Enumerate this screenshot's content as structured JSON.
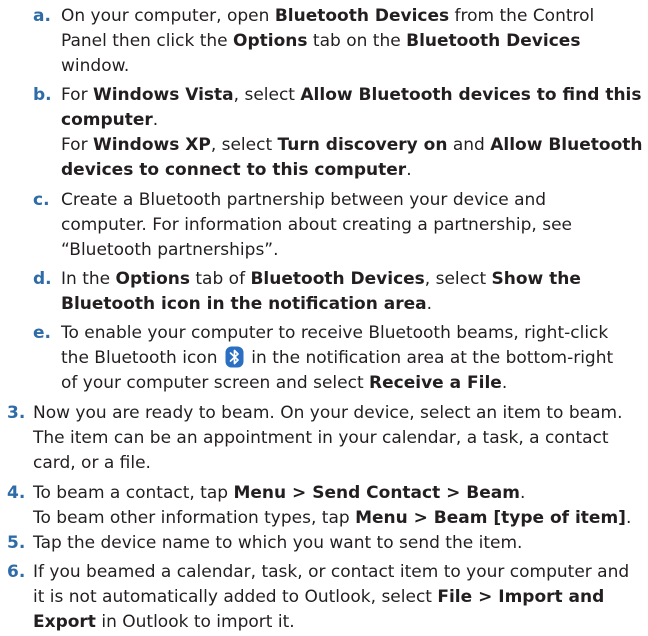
{
  "steps": {
    "a": {
      "label": "a.",
      "lines": [
        [
          "On your computer, open ",
          "Bluetooth Devices",
          " from the Control"
        ],
        [
          "Panel then click the ",
          "Options",
          " tab on the ",
          "Bluetooth Devices"
        ],
        [
          "window."
        ]
      ]
    },
    "b": {
      "label": "b.",
      "lines": [
        [
          "For ",
          "Windows Vista",
          ", select ",
          "Allow Bluetooth devices to find this"
        ],
        [
          "computer",
          "."
        ],
        [
          "For ",
          "Windows XP",
          ", select ",
          "Turn discovery on",
          " and ",
          "Allow Bluetooth"
        ],
        [
          "devices to connect to this computer",
          "."
        ]
      ]
    },
    "c": {
      "label": "c.",
      "lines": [
        [
          "Create a Bluetooth partnership between your device and"
        ],
        [
          "computer. For information about creating a partnership, see"
        ],
        [
          "“Bluetooth partnerships”."
        ]
      ]
    },
    "d": {
      "label": "d.",
      "lines": [
        [
          "In the ",
          "Options",
          " tab of ",
          "Bluetooth Devices",
          ", select ",
          "Show the"
        ],
        [
          "Bluetooth icon in the notification area",
          "."
        ]
      ]
    },
    "e": {
      "label": "e.",
      "lines": [
        [
          "To enable your computer to receive Bluetooth beams, right-click"
        ],
        [
          "the Bluetooth icon ",
          " in the notification area at the bottom-right"
        ],
        [
          "of your computer screen and select ",
          "Receive a File",
          "."
        ]
      ]
    },
    "s3": {
      "label": "3.",
      "lines": [
        [
          "Now you are ready to beam. On your device, select an item to beam."
        ],
        [
          "The item can be an appointment in your calendar, a task, a contact"
        ],
        [
          "card, or a file."
        ]
      ]
    },
    "s4": {
      "label": "4.",
      "lines": [
        [
          "To beam a contact, tap ",
          "Menu > Send Contact > Beam",
          "."
        ],
        [
          "To beam other information types, tap ",
          "Menu > Beam [type of item]",
          "."
        ]
      ]
    },
    "s5": {
      "label": "5.",
      "lines": [
        [
          "Tap the device name to which you want to send the item."
        ]
      ]
    },
    "s6": {
      "label": "6.",
      "lines": [
        [
          "If you beamed a calendar, task, or contact item to your computer and"
        ],
        [
          "it is not automatically added to Outlook, select ",
          "File > Import and"
        ],
        [
          "Export",
          " in Outlook to import it."
        ]
      ]
    }
  },
  "icons": {
    "bluetooth": "bluetooth-icon",
    "bluetooth_color": "#2a6fc1"
  }
}
